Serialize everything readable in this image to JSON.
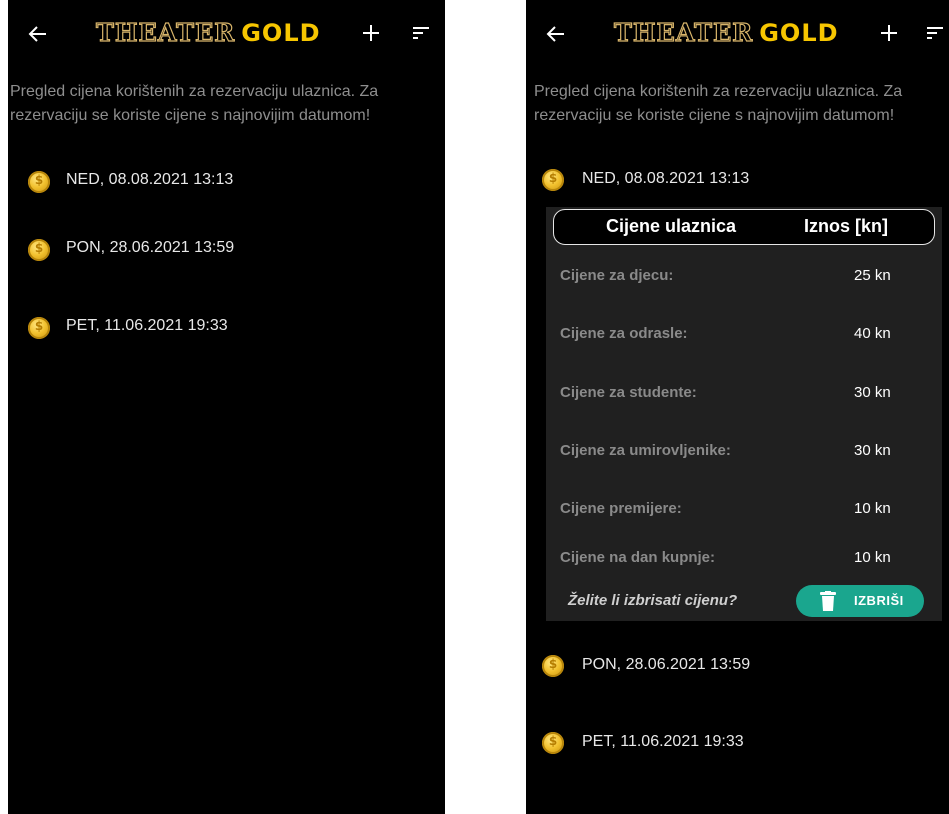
{
  "app": {
    "title_part1": "THEATER",
    "title_part2": "GOLD",
    "colors": {
      "background": "#000000",
      "gold": "#f7c600",
      "accent": "#1aa68e",
      "panel": "#202020"
    }
  },
  "icons": {
    "back": "arrow-left-icon",
    "add": "plus-icon",
    "sort": "sort-icon",
    "coin": "coin-icon",
    "delete": "trash-icon"
  },
  "description": "Pregled cijena korištenih za rezervaciju ulaznica. Za rezervaciju se koriste cijene s najnovijim datumom!",
  "price_lists": [
    {
      "date": "NED, 08.08.2021 13:13"
    },
    {
      "date": "PON, 28.06.2021 13:59"
    },
    {
      "date": "PET, 11.06.2021 19:33"
    }
  ],
  "expanded": {
    "header_left": "Cijene ulaznica",
    "header_right": "Iznos [kn]",
    "rows": [
      {
        "label": "Cijene za djecu:",
        "amount": "25 kn"
      },
      {
        "label": "Cijene za odrasle:",
        "amount": "40 kn"
      },
      {
        "label": "Cijene za studente:",
        "amount": "30 kn"
      },
      {
        "label": "Cijene za umirovljenike:",
        "amount": "30 kn"
      },
      {
        "label": "Cijene premijere:",
        "amount": "10 kn"
      },
      {
        "label": "Cijene na dan kupnje:",
        "amount": "10 kn"
      }
    ],
    "delete_question": "Želite li izbrisati cijenu?",
    "delete_button": "IZBRIŠI"
  }
}
